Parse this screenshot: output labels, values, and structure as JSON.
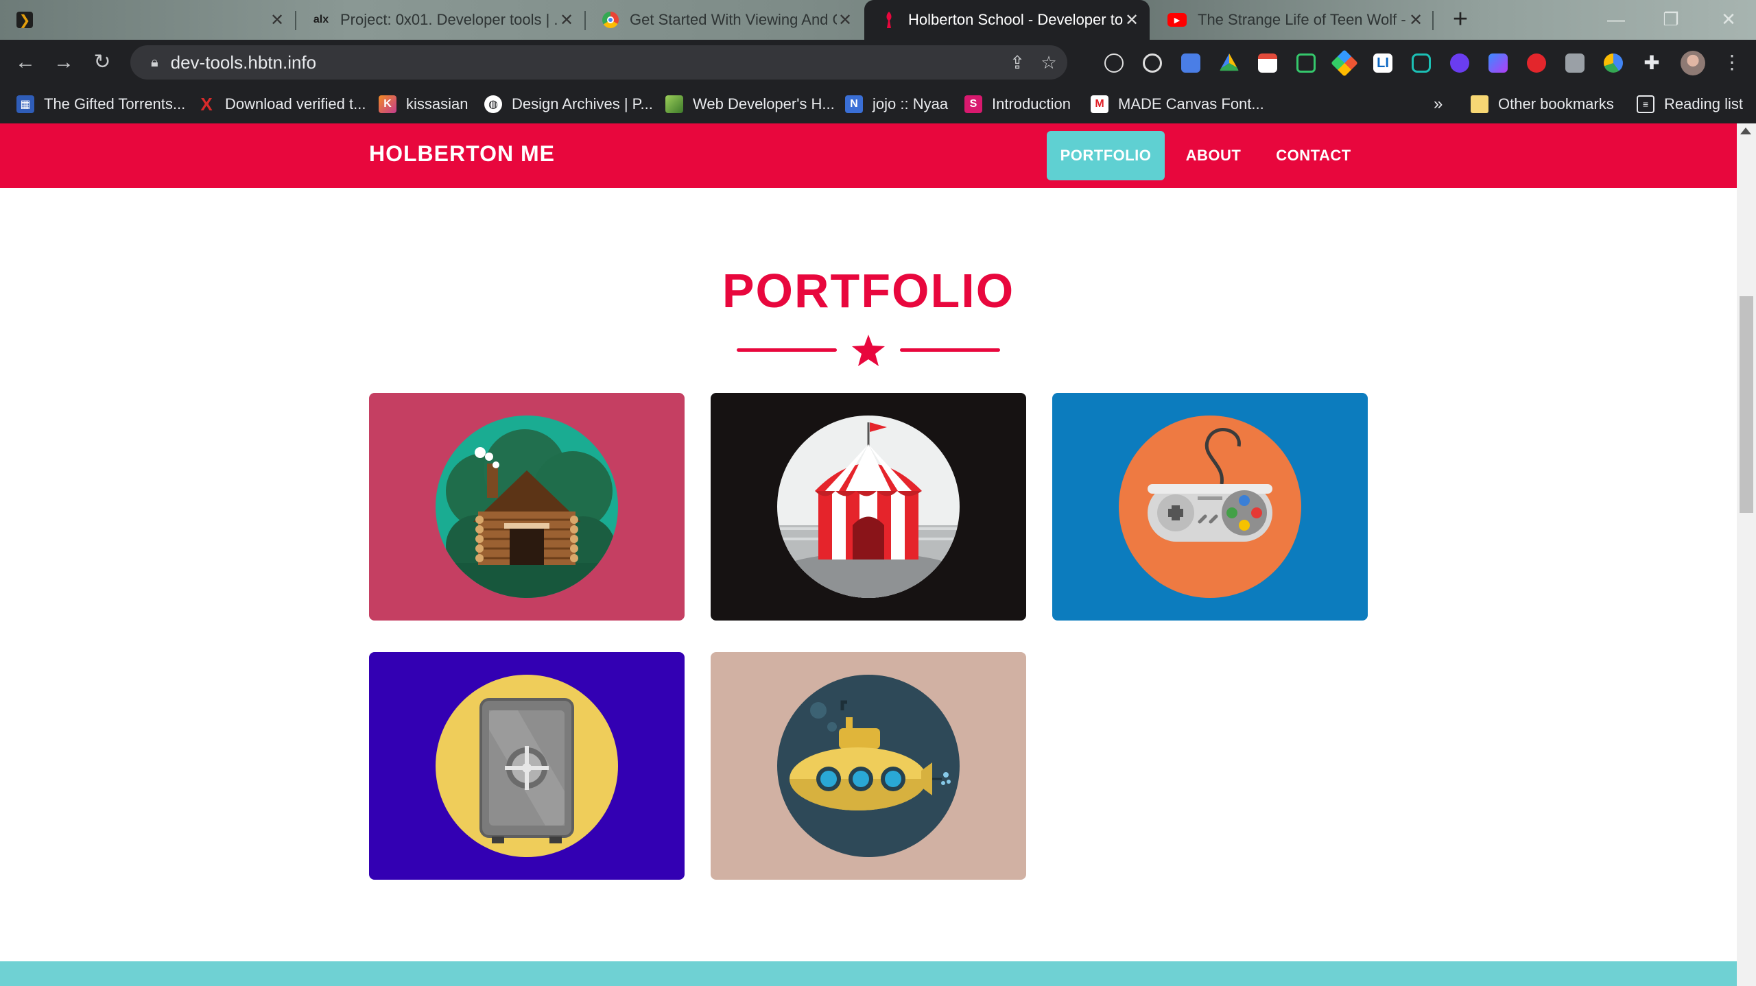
{
  "browser": {
    "tabs": [
      {
        "title": "",
        "favicon": "plex-icon",
        "active": false
      },
      {
        "title": "Project: 0x01. Developer tools | ...",
        "favicon": "alx-icon",
        "active": false
      },
      {
        "title": "Get Started With Viewing And Cl",
        "favicon": "chrome-icon",
        "active": false
      },
      {
        "title": "Holberton School - Developer to",
        "favicon": "holberton-icon",
        "active": true
      },
      {
        "title": "The Strange Life of Teen Wolf - Y",
        "favicon": "youtube-icon",
        "active": false
      }
    ],
    "new_tab_label": "+",
    "url": "dev-tools.hbtn.info",
    "bookmarks": [
      {
        "label": "The Gifted Torrents...",
        "icon": "torrent-icon",
        "color": "#2f5db8"
      },
      {
        "label": "Download verified t...",
        "icon": "x-icon",
        "color": "#d92b2b"
      },
      {
        "label": "kissasian",
        "icon": "k-icon",
        "color": "#c33c8f"
      },
      {
        "label": "Design Archives | P...",
        "icon": "globe-icon",
        "color": "#ffffff"
      },
      {
        "label": "Web Developer's H...",
        "icon": "bookmark-page-icon",
        "color": "#6fa84a"
      },
      {
        "label": "jojo :: Nyaa",
        "icon": "nyaa-icon",
        "color": "#3a6fd6"
      },
      {
        "label": "Introduction",
        "icon": "s-icon",
        "color": "#d8196e"
      },
      {
        "label": "MADE Canvas Font...",
        "icon": "made-icon",
        "color": "#e01e26"
      }
    ],
    "overflow_label": "»",
    "other_bookmarks": "Other bookmarks",
    "reading_list": "Reading list"
  },
  "site": {
    "brand": "HOLBERTON ME",
    "nav": [
      {
        "label": "PORTFOLIO",
        "active": true
      },
      {
        "label": "ABOUT",
        "active": false
      },
      {
        "label": "CONTACT",
        "active": false
      }
    ],
    "section_title": "PORTFOLIO",
    "colors": {
      "primary": "#e8073d",
      "accent": "#5fd0d2"
    },
    "portfolio": [
      {
        "name": "cabin",
        "background": "#c53f62",
        "circle": "#1aac92"
      },
      {
        "name": "circus",
        "background": "#161212",
        "circle": "#eef0f0"
      },
      {
        "name": "game-controller",
        "background": "#0c7cbe",
        "circle": "#ee7a42"
      },
      {
        "name": "safe",
        "background": "#3300b3",
        "circle": "#efcd5a"
      },
      {
        "name": "submarine",
        "background": "#d1b1a3",
        "circle": "#2e4958"
      }
    ]
  }
}
